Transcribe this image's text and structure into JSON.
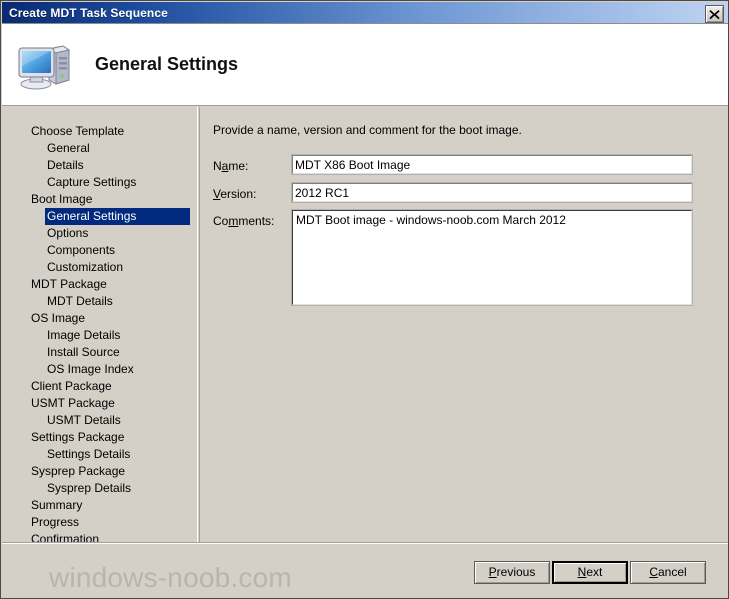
{
  "window": {
    "title": "Create MDT Task Sequence",
    "close_label": "x",
    "close_icon": "close-icon"
  },
  "header": {
    "title": "General Settings",
    "icon": "computer-icon"
  },
  "sidebar": {
    "items": [
      {
        "label": "Choose Template",
        "level": 1,
        "selected": false
      },
      {
        "label": "General",
        "level": 2,
        "selected": false
      },
      {
        "label": "Details",
        "level": 2,
        "selected": false
      },
      {
        "label": "Capture Settings",
        "level": 2,
        "selected": false
      },
      {
        "label": "Boot Image",
        "level": 1,
        "selected": false
      },
      {
        "label": "General Settings",
        "level": 2,
        "selected": true
      },
      {
        "label": "Options",
        "level": 2,
        "selected": false
      },
      {
        "label": "Components",
        "level": 2,
        "selected": false
      },
      {
        "label": "Customization",
        "level": 2,
        "selected": false
      },
      {
        "label": "MDT Package",
        "level": 1,
        "selected": false
      },
      {
        "label": "MDT Details",
        "level": 2,
        "selected": false
      },
      {
        "label": "OS Image",
        "level": 1,
        "selected": false
      },
      {
        "label": "Image Details",
        "level": 2,
        "selected": false
      },
      {
        "label": "Install Source",
        "level": 2,
        "selected": false
      },
      {
        "label": "OS Image Index",
        "level": 2,
        "selected": false
      },
      {
        "label": "Client Package",
        "level": 1,
        "selected": false
      },
      {
        "label": "USMT Package",
        "level": 1,
        "selected": false
      },
      {
        "label": "USMT Details",
        "level": 2,
        "selected": false
      },
      {
        "label": "Settings Package",
        "level": 1,
        "selected": false
      },
      {
        "label": "Settings Details",
        "level": 2,
        "selected": false
      },
      {
        "label": "Sysprep Package",
        "level": 1,
        "selected": false
      },
      {
        "label": "Sysprep Details",
        "level": 2,
        "selected": false
      },
      {
        "label": "Summary",
        "level": 1,
        "selected": false
      },
      {
        "label": "Progress",
        "level": 1,
        "selected": false
      },
      {
        "label": "Confirmation",
        "level": 1,
        "selected": false
      }
    ]
  },
  "content": {
    "instruction": "Provide a name, version and comment for the boot image.",
    "fields": {
      "name": {
        "label_before": "N",
        "label_accel": "a",
        "label_after": "me:",
        "value": "MDT X86 Boot Image"
      },
      "version": {
        "label_before": "",
        "label_accel": "V",
        "label_after": "ersion:",
        "value": "2012 RC1"
      },
      "comments": {
        "label_before": "Co",
        "label_accel": "m",
        "label_after": "ments:",
        "value": "MDT Boot image - windows-noob.com March 2012"
      }
    }
  },
  "footer": {
    "watermark": "windows-noob.com",
    "buttons": {
      "previous": {
        "before": "",
        "accel": "P",
        "after": "revious"
      },
      "next": {
        "before": "",
        "accel": "N",
        "after": "ext"
      },
      "cancel": {
        "before": "",
        "accel": "C",
        "after": "ancel"
      }
    }
  },
  "colors": {
    "titlebar_dark": "#0a2a72",
    "titlebar_light": "#bfd3f0",
    "dialog_face": "#d4d0c8",
    "selection": "#012a7f",
    "watermark": "#b9b5ad"
  }
}
